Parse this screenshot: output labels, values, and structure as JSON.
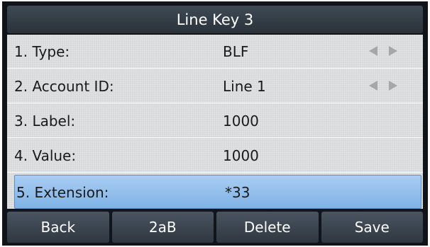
{
  "title": "Line Key 3",
  "rows": [
    {
      "label": "1. Type:",
      "value": "BLF",
      "has_arrows": true
    },
    {
      "label": "2. Account ID:",
      "value": "Line 1",
      "has_arrows": true
    },
    {
      "label": "3. Label:",
      "value": "1000",
      "has_arrows": false
    },
    {
      "label": "4. Value:",
      "value": "1000",
      "has_arrows": false
    },
    {
      "label": "5. Extension:",
      "value": "*33",
      "has_arrows": false,
      "selected": true
    }
  ],
  "softkeys": [
    "Back",
    "2aB",
    "Delete",
    "Save"
  ],
  "colors": {
    "title_bar": "#333c45",
    "selection": "#94c0ec",
    "list_bg": "#d6d8d9",
    "softkey": "#3b4550"
  },
  "icons": {
    "left": "arrow-left-icon",
    "right": "arrow-right-icon"
  }
}
